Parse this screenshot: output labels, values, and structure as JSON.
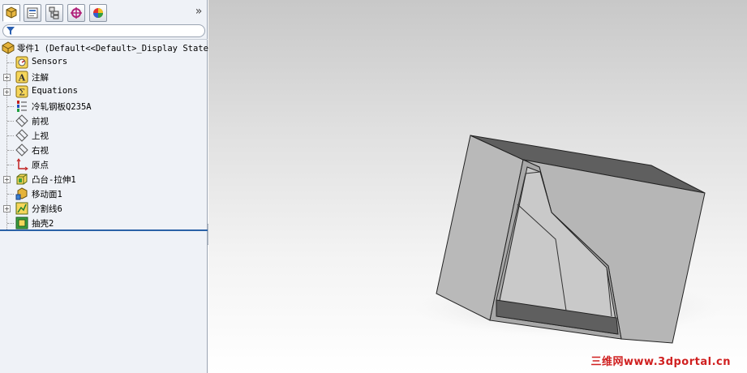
{
  "feature_manager": {
    "tabs": [
      {
        "name": "FeatureManager design tree",
        "icon": "feature-tree-icon"
      },
      {
        "name": "PropertyManager",
        "icon": "property-manager-icon"
      },
      {
        "name": "ConfigurationManager",
        "icon": "configuration-manager-icon"
      },
      {
        "name": "DimXpertManager",
        "icon": "dimxpert-icon"
      },
      {
        "name": "DisplayManager",
        "icon": "display-manager-icon"
      }
    ],
    "more_glyph": "»",
    "filter_icon": "filter-icon",
    "tree": {
      "root": {
        "label": "零件1  (Default<<Default>_Display State",
        "icon": "part-icon"
      },
      "items": [
        {
          "label": "Sensors",
          "icon": "sensors-icon",
          "expandable": false
        },
        {
          "label": "注解",
          "icon": "annotations-icon",
          "expandable": true
        },
        {
          "label": "Equations",
          "icon": "equations-icon",
          "expandable": true
        },
        {
          "label": "冷轧钢板Q235A",
          "icon": "material-icon",
          "expandable": false
        },
        {
          "label": "前视",
          "icon": "plane-icon",
          "expandable": false
        },
        {
          "label": "上视",
          "icon": "plane-icon",
          "expandable": false
        },
        {
          "label": "右视",
          "icon": "plane-icon",
          "expandable": false
        },
        {
          "label": "原点",
          "icon": "origin-icon",
          "expandable": false
        },
        {
          "label": "凸台-拉伸1",
          "icon": "boss-extrude-icon",
          "expandable": true
        },
        {
          "label": "移动面1",
          "icon": "move-face-icon",
          "expandable": false
        },
        {
          "label": "分割线6",
          "icon": "split-line-icon",
          "expandable": true
        },
        {
          "label": "抽壳2",
          "icon": "shell-icon",
          "expandable": false
        }
      ]
    }
  },
  "viewport": {
    "model_icon": "shelled-box-model",
    "watermark": "三维网www.3dportal.cn"
  },
  "colors": {
    "panel_bg": "#eff2f7",
    "rollback_bar": "#2b62a7",
    "watermark": "#d02020"
  }
}
